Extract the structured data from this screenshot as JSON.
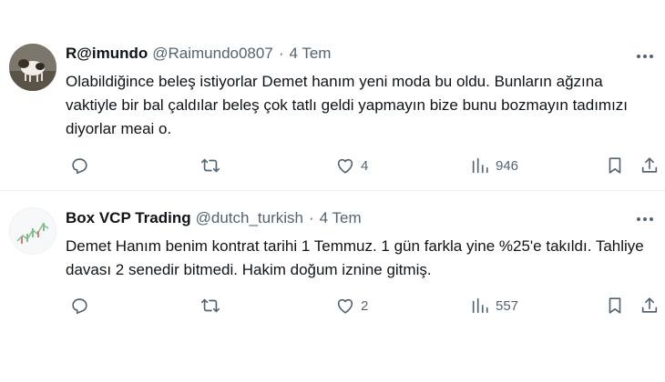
{
  "tweets": [
    {
      "name": "R@imundo",
      "handle": "@Raimundo0807",
      "separator": "·",
      "time": "4 Tem",
      "text": "Olabildiğince beleş istiyorlar Demet hanım yeni moda bu oldu. Bunların ağzına vaktiyle bir bal çaldılar beleş çok tatlı geldi yapmayın bize bunu bozmayın tadımızı diyorlar meai o.",
      "likes": "4",
      "views": "946"
    },
    {
      "name": "Box VCP Trading",
      "handle": "@dutch_turkish",
      "separator": "·",
      "time": "4 Tem",
      "text": "Demet Hanım benim kontrat tarihi 1 Temmuz. 1 gün farkla yine %25'e takıldı. Tahliye davası 2 senedir bitmedi. Hakim doğum iznine gitmiş.",
      "likes": "2",
      "views": "557"
    }
  ],
  "icons": {
    "reply": "reply-icon",
    "retweet": "retweet-icon",
    "like": "heart-icon",
    "views": "views-icon",
    "bookmark": "bookmark-icon",
    "share": "share-icon",
    "more": "more-icon"
  },
  "colors": {
    "text": "#0f1419",
    "secondary": "#536471",
    "divider": "#e6ecf0"
  }
}
